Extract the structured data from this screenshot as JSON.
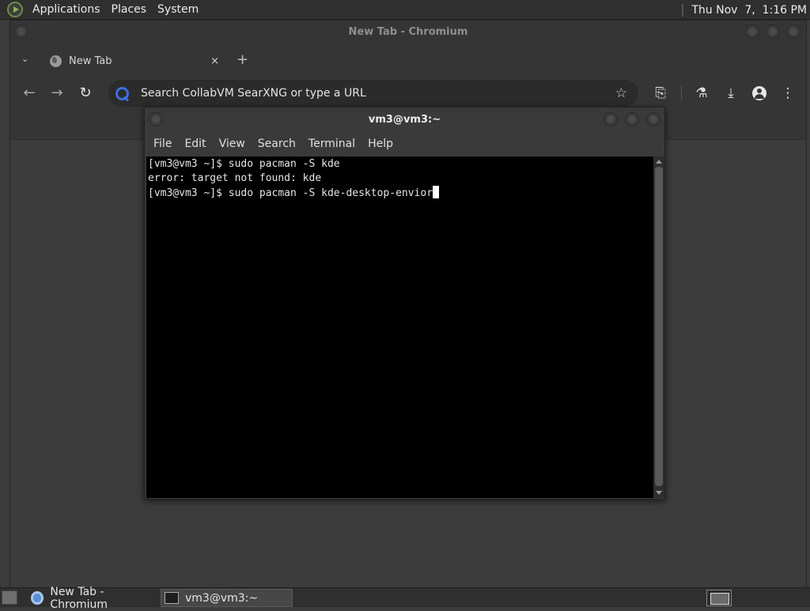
{
  "top_panel": {
    "menus": [
      "Applications",
      "Places",
      "System"
    ],
    "clock": "Thu Nov  7,  1:16 PM"
  },
  "chromium": {
    "window_title": "New Tab - Chromium",
    "tab": {
      "title": "New Tab",
      "close": "×"
    },
    "new_tab": "+",
    "omnibox_placeholder": "Search CollabVM SearXNG or type a URL"
  },
  "terminal": {
    "window_title": "vm3@vm3:~",
    "menus": [
      "File",
      "Edit",
      "View",
      "Search",
      "Terminal",
      "Help"
    ],
    "lines": [
      "[vm3@vm3 ~]$ sudo pacman -S kde",
      "error: target not found: kde",
      "[vm3@vm3 ~]$ sudo pacman -S kde-desktop-envior"
    ]
  },
  "taskbar": {
    "tasks": [
      "New Tab - Chromium",
      "vm3@vm3:~"
    ]
  }
}
